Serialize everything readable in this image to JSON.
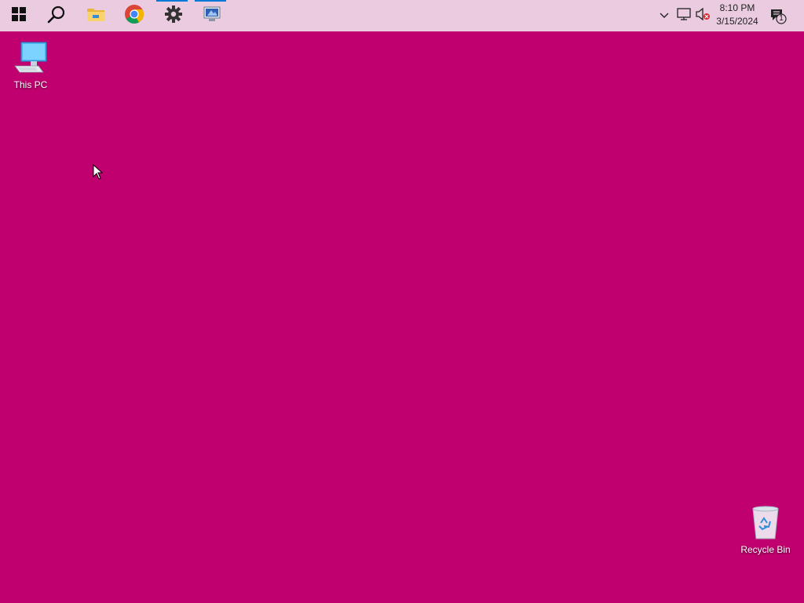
{
  "desktop": {
    "background_color": "#c1006f",
    "icons": [
      {
        "label": "This PC",
        "icon": "computer-icon"
      },
      {
        "label": "Recycle Bin",
        "icon": "recycle-bin-icon"
      }
    ]
  },
  "taskbar": {
    "background_color": "#eacbe0",
    "buttons": [
      {
        "name": "start",
        "icon": "windows-logo-icon"
      },
      {
        "name": "search",
        "icon": "search-icon"
      },
      {
        "name": "file-explorer",
        "icon": "folder-icon"
      },
      {
        "name": "chrome",
        "icon": "chrome-icon"
      },
      {
        "name": "settings",
        "icon": "gear-icon",
        "active": true
      },
      {
        "name": "remote-desktop",
        "icon": "remote-desktop-icon",
        "active": true
      }
    ],
    "tray": {
      "time": "8:10 PM",
      "date": "3/15/2024",
      "notification_count": "1"
    }
  }
}
